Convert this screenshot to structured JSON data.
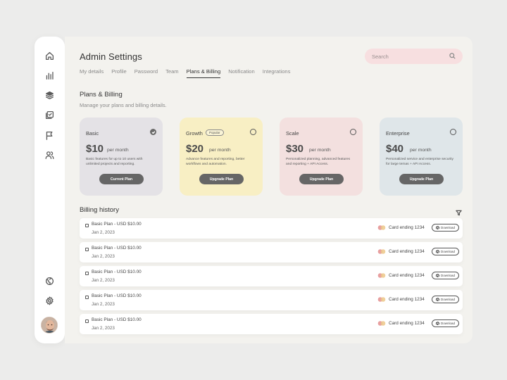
{
  "header": {
    "title": "Admin Settings"
  },
  "tabs": [
    {
      "label": "My details"
    },
    {
      "label": "Profile"
    },
    {
      "label": "Password"
    },
    {
      "label": "Team"
    },
    {
      "label": "Plans & Billing",
      "active": true
    },
    {
      "label": "Notification"
    },
    {
      "label": "Integrations"
    }
  ],
  "search": {
    "placeholder": "Search",
    "icon": "search-icon"
  },
  "sidebar": {
    "items": [
      {
        "icon": "home-icon"
      },
      {
        "icon": "bar-chart-icon"
      },
      {
        "icon": "layers-icon"
      },
      {
        "icon": "checklist-icon"
      },
      {
        "icon": "flag-icon"
      },
      {
        "icon": "users-icon"
      }
    ],
    "bottom": [
      {
        "icon": "globe-icon"
      },
      {
        "icon": "gear-icon"
      }
    ],
    "avatar": "avatar"
  },
  "plans_section": {
    "title": "Plans & Billing",
    "subtitle": "Manage your plans and billing details."
  },
  "plans": [
    {
      "name": "Basic",
      "badge": "",
      "price": "$10",
      "per": "per month",
      "desc": "Basic features for up to 10 users with unlimited projects and reporting.",
      "button": "Current Plan",
      "selected": true,
      "color": "#e4e2e6"
    },
    {
      "name": "Growth",
      "badge": "Popular",
      "price": "$20",
      "per": "per month",
      "desc": "Advance features and reporting, better workflows and automation.",
      "button": "Upgrade Plan",
      "selected": false,
      "color": "#f8efc4"
    },
    {
      "name": "Scale",
      "badge": "",
      "price": "$30",
      "per": "per month",
      "desc": "Personalized planning, advanced features and reporting + API Access.",
      "button": "Upgrade Plan",
      "selected": false,
      "color": "#f3e0df"
    },
    {
      "name": "Enterprise",
      "badge": "",
      "price": "$40",
      "per": "per month",
      "desc": "Personalized service and enterprise security for large temas + API Access.",
      "button": "Upgrade Plan",
      "selected": false,
      "color": "#dfe6e9"
    }
  ],
  "billing": {
    "title": "Billing history",
    "filter_icon": "filter-icon",
    "rows": [
      {
        "plan": "Basic Plan - USD $10.00",
        "date": "Jan 2, 2023",
        "card": "Card ending 1234",
        "action": "Download"
      },
      {
        "plan": "Basic Plan - USD $10.00",
        "date": "Jan 2, 2023",
        "card": "Card ending 1234",
        "action": "Download"
      },
      {
        "plan": "Basic Plan - USD $10.00",
        "date": "Jan 2, 2023",
        "card": "Card ending 1234",
        "action": "Download"
      },
      {
        "plan": "Basic Plan - USD $10.00",
        "date": "Jan 2, 2023",
        "card": "Card ending 1234",
        "action": "Download"
      },
      {
        "plan": "Basic Plan - USD $10.00",
        "date": "Jan 2, 2023",
        "card": "Card ending 1234",
        "action": "Download"
      }
    ]
  },
  "colors": {
    "accent": "#666666",
    "search_bg": "#f7dfe0",
    "panel_bg": "#f3f2ee",
    "page_bg": "#ececeb"
  }
}
